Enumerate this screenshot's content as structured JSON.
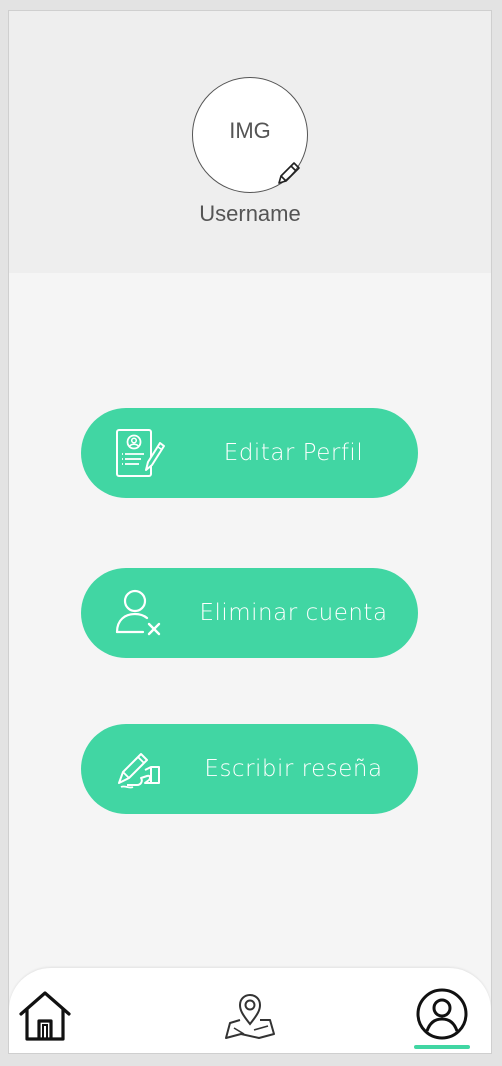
{
  "profile": {
    "avatar_placeholder": "IMG",
    "username": "Username",
    "edit_icon": "pencil-icon"
  },
  "actions": [
    {
      "label": "Editar Perfil",
      "icon": "profile-document-edit-icon"
    },
    {
      "label": "Eliminar cuenta",
      "icon": "user-remove-icon"
    },
    {
      "label": "Escribir reseña",
      "icon": "hand-writing-icon"
    }
  ],
  "nav": {
    "items": [
      {
        "icon": "home-icon",
        "active": false
      },
      {
        "icon": "map-pin-icon",
        "active": false
      },
      {
        "icon": "user-circle-icon",
        "active": true
      }
    ]
  },
  "colors": {
    "accent": "#41d6a3",
    "header_bg": "#eeeeee",
    "page_bg": "#f5f5f5"
  }
}
